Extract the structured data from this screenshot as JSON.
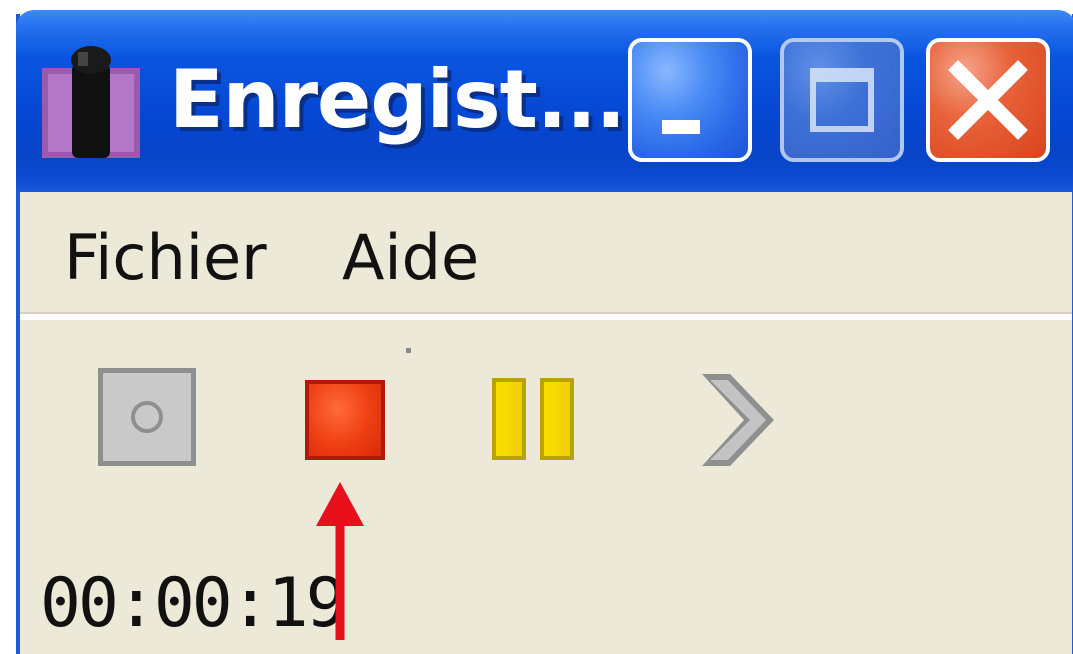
{
  "window": {
    "title": "Enregist...",
    "icon": "microphone-icon"
  },
  "titlebar_buttons": {
    "minimize": "minimize-icon",
    "maximize": "maximize-icon",
    "close": "close-icon"
  },
  "menu": {
    "items": [
      {
        "label": "Fichier"
      },
      {
        "label": "Aide"
      }
    ]
  },
  "toolbar": {
    "buttons": [
      {
        "name": "record",
        "icon": "record-icon",
        "enabled": false
      },
      {
        "name": "stop",
        "icon": "stop-icon",
        "enabled": true,
        "color": "#ee3e12"
      },
      {
        "name": "pause",
        "icon": "pause-icon",
        "enabled": true,
        "color": "#f8e000"
      },
      {
        "name": "play",
        "icon": "chevron-right-icon",
        "enabled": false
      }
    ]
  },
  "status": {
    "elapsed": "00:00:19"
  },
  "annotation": {
    "type": "arrow",
    "color": "#e8101a",
    "points_to": "stop-button"
  },
  "colors": {
    "titlebar": "#0648d4",
    "window_bg": "#ece9d8",
    "close_button": "#e8623a"
  }
}
